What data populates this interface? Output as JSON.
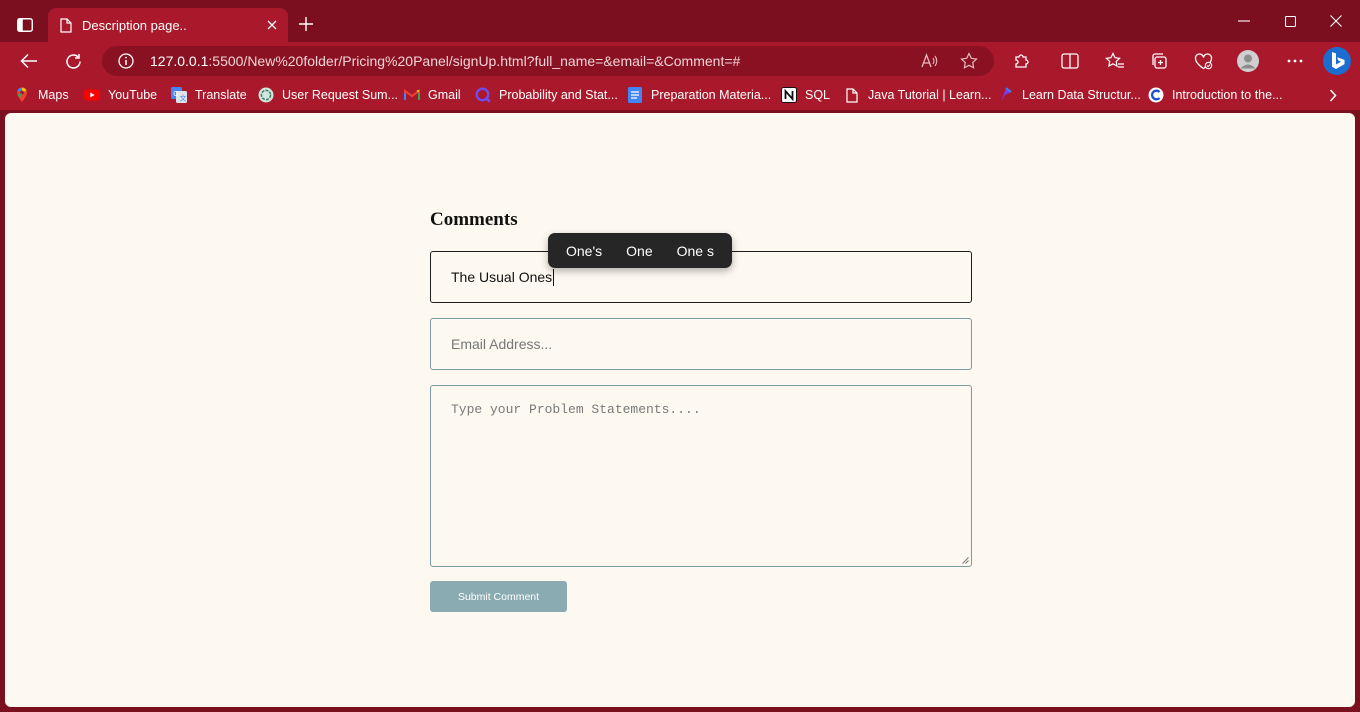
{
  "browser": {
    "tab_title": "Description page..",
    "url_host": "127.0.0.1",
    "url_rest": ":5500/New%20folder/Pricing%20Panel/signUp.html?full_name=&email=&Comment=#"
  },
  "bookmarks": [
    {
      "label": "Maps",
      "icon": "maps-icon"
    },
    {
      "label": "YouTube",
      "icon": "youtube-icon"
    },
    {
      "label": "Translate",
      "icon": "translate-icon"
    },
    {
      "label": "User Request Sum...",
      "icon": "chatgpt-icon"
    },
    {
      "label": "Gmail",
      "icon": "gmail-icon"
    },
    {
      "label": "Probability and Stat...",
      "icon": "q-icon"
    },
    {
      "label": "Preparation Materia...",
      "icon": "docs-icon"
    },
    {
      "label": "SQL",
      "icon": "notion-icon"
    },
    {
      "label": "Java Tutorial | Learn...",
      "icon": "page-icon"
    },
    {
      "label": "Learn Data Structur...",
      "icon": "learn-icon"
    },
    {
      "label": "Introduction to the...",
      "icon": "c-icon"
    }
  ],
  "form": {
    "heading": "Comments",
    "name_value": "The Usual Ones",
    "email_placeholder": "Email Address...",
    "comment_placeholder": "Type your Problem Statements....",
    "submit_label": "Submit Comment"
  },
  "suggestions": [
    "One's",
    "One",
    "One s"
  ],
  "colors": {
    "chrome": "#a9182b",
    "titlebar": "#7c0f1f",
    "page_bg": "#fdf9f1",
    "submit_bg": "#8aabb2",
    "field_border": "#7b9ba0"
  }
}
